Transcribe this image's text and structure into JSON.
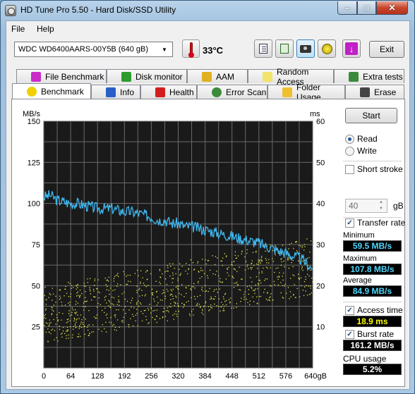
{
  "window": {
    "title": "HD Tune Pro 5.50 - Hard Disk/SSD Utility"
  },
  "menu": {
    "file": "File",
    "help": "Help"
  },
  "toolbar": {
    "drive": "WDC    WD6400AARS-00Y5B (640 gB)",
    "temperature": "33°C",
    "exit_label": "Exit"
  },
  "tabs_top": [
    "File Benchmark",
    "Disk monitor",
    "AAM",
    "Random Access",
    "Extra tests"
  ],
  "tabs_bottom": [
    "Benchmark",
    "Info",
    "Health",
    "Error Scan",
    "Folder Usage",
    "Erase"
  ],
  "side": {
    "start_label": "Start",
    "read_label": "Read",
    "write_label": "Write",
    "short_stroke_label": "Short stroke",
    "short_stroke_value": "40",
    "short_stroke_unit": "gB",
    "transfer_rate_label": "Transfer rate",
    "minimum_label": "Minimum",
    "minimum_value": "59.5 MB/s",
    "maximum_label": "Maximum",
    "maximum_value": "107.8 MB/s",
    "average_label": "Average",
    "average_value": "84.9 MB/s",
    "access_time_label": "Access time",
    "access_time_value": "18.9 ms",
    "burst_rate_label": "Burst rate",
    "burst_rate_value": "161.2 MB/s",
    "cpu_usage_label": "CPU usage",
    "cpu_usage_value": "5.2%"
  },
  "colors": {
    "transfer_line": "#3fb8f0",
    "access_dots": "#e8e84a",
    "plot_bg": "#1a1a1a"
  },
  "chart_data": {
    "type": "line",
    "title": "",
    "ylabel_left": "MB/s",
    "ylabel_right": "ms",
    "x_ticks": [
      "0",
      "64",
      "128",
      "192",
      "256",
      "320",
      "384",
      "448",
      "512",
      "576",
      "640gB"
    ],
    "y_left_ticks": [
      "25",
      "50",
      "75",
      "100",
      "125",
      "150"
    ],
    "y_right_ticks": [
      "10",
      "20",
      "30",
      "40",
      "50",
      "60"
    ],
    "xlim": [
      0,
      640
    ],
    "ylim_left": [
      0,
      150
    ],
    "ylim_right": [
      0,
      60
    ],
    "series": [
      {
        "name": "Transfer rate",
        "axis": "left",
        "x": [
          0,
          16,
          32,
          48,
          64,
          80,
          96,
          112,
          128,
          144,
          160,
          176,
          192,
          208,
          224,
          240,
          256,
          272,
          288,
          304,
          320,
          336,
          352,
          368,
          384,
          400,
          416,
          432,
          448,
          464,
          480,
          496,
          512,
          528,
          544,
          560,
          576,
          592,
          608,
          624,
          640
        ],
        "y": [
          104,
          105,
          102,
          101,
          100,
          100,
          99,
          98,
          97,
          97,
          97,
          96,
          95,
          95,
          94,
          93,
          92,
          90,
          90,
          88,
          88,
          86,
          86,
          85,
          84,
          83,
          82,
          81,
          80,
          79,
          78,
          77,
          76,
          74,
          73,
          71,
          70,
          68,
          67,
          64,
          60
        ]
      },
      {
        "name": "Access time",
        "axis": "right",
        "type": "scatter",
        "x_range": [
          0,
          640
        ],
        "y_min_at_start": 6,
        "y_max_at_start": 20,
        "y_min_at_end": 18,
        "y_max_at_end": 32
      }
    ]
  }
}
